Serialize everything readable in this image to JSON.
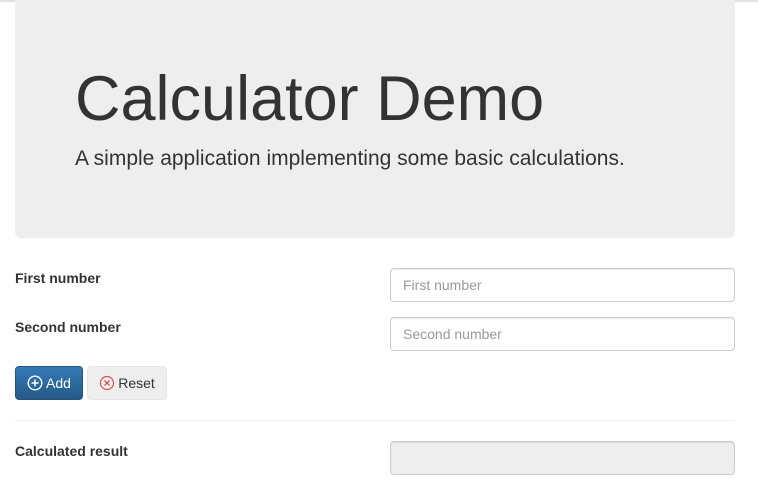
{
  "header": {
    "title": "Calculator Demo",
    "subtitle": "A simple application implementing some basic calculations."
  },
  "form": {
    "first_label": "First number",
    "first_placeholder": "First number",
    "first_value": "",
    "second_label": "Second number",
    "second_placeholder": "Second number",
    "second_value": "",
    "add_label": "Add",
    "add_icon": "plus-circle-icon",
    "reset_label": "Reset",
    "reset_icon": "remove-circle-icon",
    "result_label": "Calculated result",
    "result_value": ""
  },
  "colors": {
    "primary": "#337ab7",
    "jumbotron_bg": "#eeeeee",
    "reset_icon": "#d9534f"
  }
}
